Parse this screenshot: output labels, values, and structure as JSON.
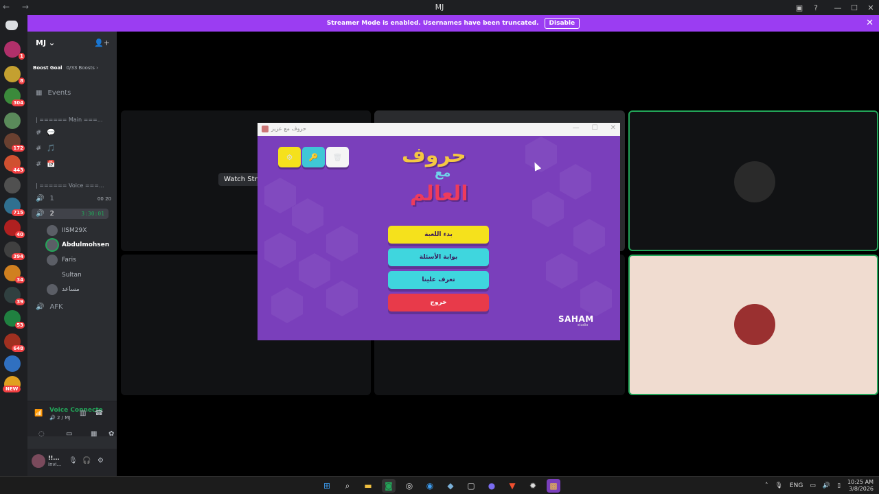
{
  "window": {
    "title": "MJ",
    "nav": [
      "←",
      "→"
    ],
    "controls": [
      "▣",
      "?",
      "—",
      "☐",
      "✕"
    ]
  },
  "banner": {
    "text": "Streamer Mode is enabled. Usernames have been truncated.",
    "button": "Disable",
    "close": "✕"
  },
  "rail": {
    "badges": [
      "1",
      "8",
      "304",
      "172",
      "443",
      "715",
      "40",
      "394",
      "34",
      "39",
      "53",
      "648"
    ],
    "new_label": "NEW"
  },
  "sidebar": {
    "server_name": "MJ ⌄",
    "add_icon": "👤+",
    "boost_goal": "Boost Goal",
    "boost_count": "0/33 Boosts ›",
    "events": "Events",
    "category_main": "| ====== Main ===...",
    "category_voice": "| ====== Voice ===...",
    "text_channels": [
      "💬",
      "🎵",
      "📅"
    ],
    "voice_1": {
      "name": "1",
      "count_a": "00",
      "count_b": "20"
    },
    "voice_2": {
      "name": "2",
      "timer": "3:30:01"
    },
    "users": [
      "IISM29X",
      "Abdulmohsen",
      "Faris",
      "Sultan",
      "مساعد"
    ],
    "afk": "AFK"
  },
  "voice_panel": {
    "status": "Voice Connecte",
    "sub": "🔊 2 / MJ"
  },
  "user_panel": {
    "name": "!!...",
    "status": "Invi..."
  },
  "stage": {
    "watch_label": "Watch Stre"
  },
  "game": {
    "window_title": "حروف مع عزيز",
    "logo_line1": "حروف",
    "logo_line2": "مع",
    "logo_line3": "العالم",
    "buttons": [
      "بدء اللعبة",
      "بوابة الأسئلة",
      "تعرف علينا",
      "خروج"
    ],
    "icons": [
      "⚙",
      "🔑",
      "🗑"
    ],
    "brand": "SAHAM",
    "brand_sub": "studio"
  },
  "taskbar": {
    "lang": "ENG",
    "time": "10:25 AM",
    "date": "3/8/2026"
  },
  "colors": {
    "accent": "#9b3df2",
    "game_bg": "#7a3fbb",
    "btn_yellow": "#f5e11c",
    "btn_cyan": "#3fd6de",
    "btn_red": "#e83a4a",
    "speaking": "#23a559"
  }
}
